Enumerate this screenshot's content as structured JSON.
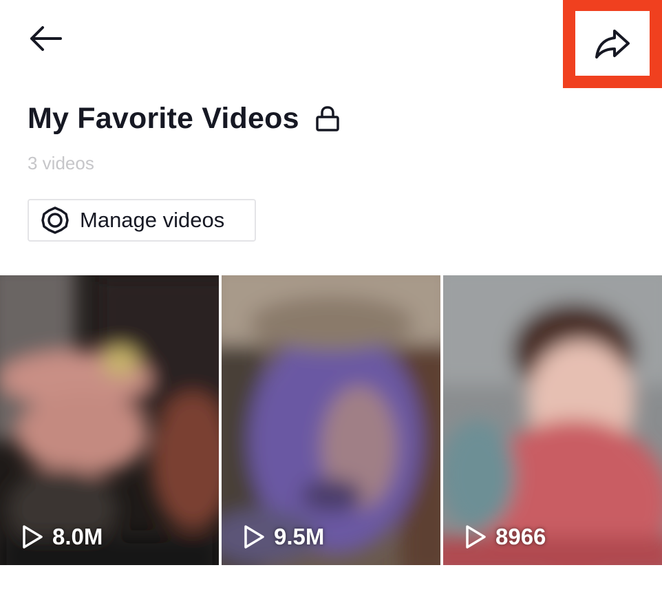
{
  "header": {
    "back_icon": "arrow-left-icon",
    "share_icon": "share-arrow-icon",
    "highlight_color": "#f0401f"
  },
  "playlist": {
    "title": "My Favorite Videos",
    "privacy_icon": "lock-icon",
    "count_label": "3 videos"
  },
  "manage": {
    "icon": "gear-icon",
    "label": "Manage videos"
  },
  "videos": [
    {
      "views": "8.0M",
      "icon": "play-icon"
    },
    {
      "views": "9.5M",
      "icon": "play-icon"
    },
    {
      "views": "8966",
      "icon": "play-icon"
    }
  ]
}
